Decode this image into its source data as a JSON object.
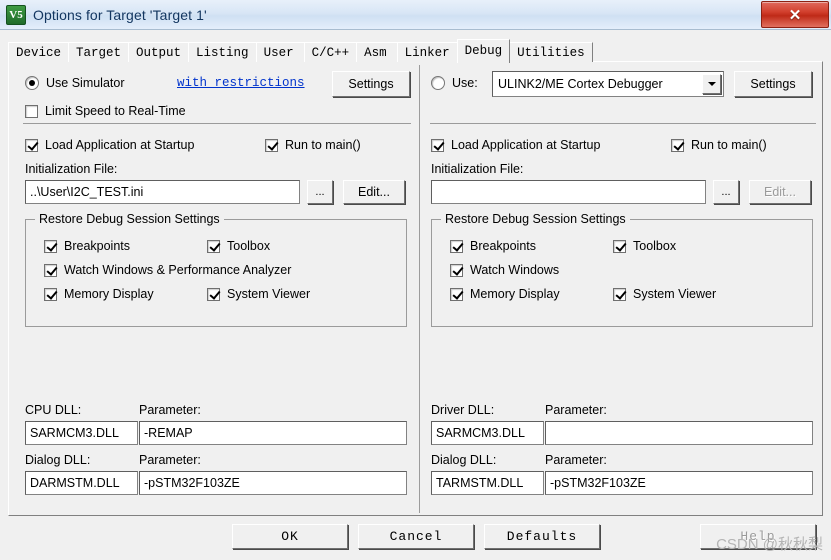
{
  "window": {
    "title": "Options for Target 'Target 1'",
    "icon_label": "uvision-v5-icon",
    "icon_glyph": "V5",
    "close_label": "✕",
    "titlebar_accent": "#12355f",
    "close_accent": "#c12e1a"
  },
  "tabs": [
    {
      "label": "Device",
      "selected": false
    },
    {
      "label": "Target",
      "selected": false
    },
    {
      "label": "Output",
      "selected": false
    },
    {
      "label": "Listing",
      "selected": false
    },
    {
      "label": "User",
      "selected": false
    },
    {
      "label": "C/C++",
      "selected": false
    },
    {
      "label": "Asm",
      "selected": false
    },
    {
      "label": "Linker",
      "selected": false
    },
    {
      "label": "Debug",
      "selected": true
    },
    {
      "label": "Utilities",
      "selected": false
    }
  ],
  "left_panel": {
    "use_simulator_label": "Use Simulator",
    "use_simulator_checked": true,
    "restrictions_link": "with restrictions",
    "settings_button": "Settings",
    "limit_speed_label": "Limit Speed to Real-Time",
    "limit_speed_checked": false,
    "load_app_label": "Load Application at Startup",
    "load_app_checked": true,
    "run_to_main_label": "Run to main()",
    "run_to_main_checked": true,
    "init_file_caption": "Initialization File:",
    "init_file_value": "..\\User\\I2C_TEST.ini",
    "browse_button": "...",
    "edit_button": "Edit...",
    "edit_disabled": false,
    "restore_group_title": "Restore Debug Session Settings",
    "restore_items": [
      {
        "label": "Breakpoints",
        "checked": true
      },
      {
        "label": "Toolbox",
        "checked": true
      },
      {
        "label": "Watch Windows & Performance Analyzer",
        "checked": true
      },
      {
        "label": "Memory Display",
        "checked": true
      },
      {
        "label": "System Viewer",
        "checked": true
      }
    ],
    "cpu_dll_caption": "CPU DLL:",
    "cpu_dll_value": "SARMCM3.DLL",
    "cpu_param_caption": "Parameter:",
    "cpu_param_value": "-REMAP",
    "dialog_dll_caption": "Dialog DLL:",
    "dialog_dll_value": "DARMSTM.DLL",
    "dialog_param_caption": "Parameter:",
    "dialog_param_value": "-pSTM32F103ZE"
  },
  "right_panel": {
    "use_label": "Use:",
    "use_checked": false,
    "debugger_value": "ULINK2/ME Cortex Debugger",
    "settings_button": "Settings",
    "load_app_label": "Load Application at Startup",
    "load_app_checked": true,
    "run_to_main_label": "Run to main()",
    "run_to_main_checked": true,
    "init_file_caption": "Initialization File:",
    "init_file_value": "",
    "browse_button": "...",
    "edit_button": "Edit...",
    "edit_disabled": true,
    "restore_group_title": "Restore Debug Session Settings",
    "restore_items": [
      {
        "label": "Breakpoints",
        "checked": true
      },
      {
        "label": "Toolbox",
        "checked": true
      },
      {
        "label": "Watch Windows",
        "checked": true
      },
      {
        "label": "Memory Display",
        "checked": true
      },
      {
        "label": "System Viewer",
        "checked": true
      }
    ],
    "driver_dll_caption": "Driver DLL:",
    "driver_dll_value": "SARMCM3.DLL",
    "driver_param_caption": "Parameter:",
    "driver_param_value": "",
    "dialog_dll_caption": "Dialog DLL:",
    "dialog_dll_value": "TARMSTM.DLL",
    "dialog_param_caption": "Parameter:",
    "dialog_param_value": "-pSTM32F103ZE"
  },
  "footer": {
    "ok_button": "OK",
    "cancel_button": "Cancel",
    "defaults_button": "Defaults",
    "help_button": "Help",
    "help_disabled": true
  },
  "watermark": "CSDN @秋秋梨"
}
